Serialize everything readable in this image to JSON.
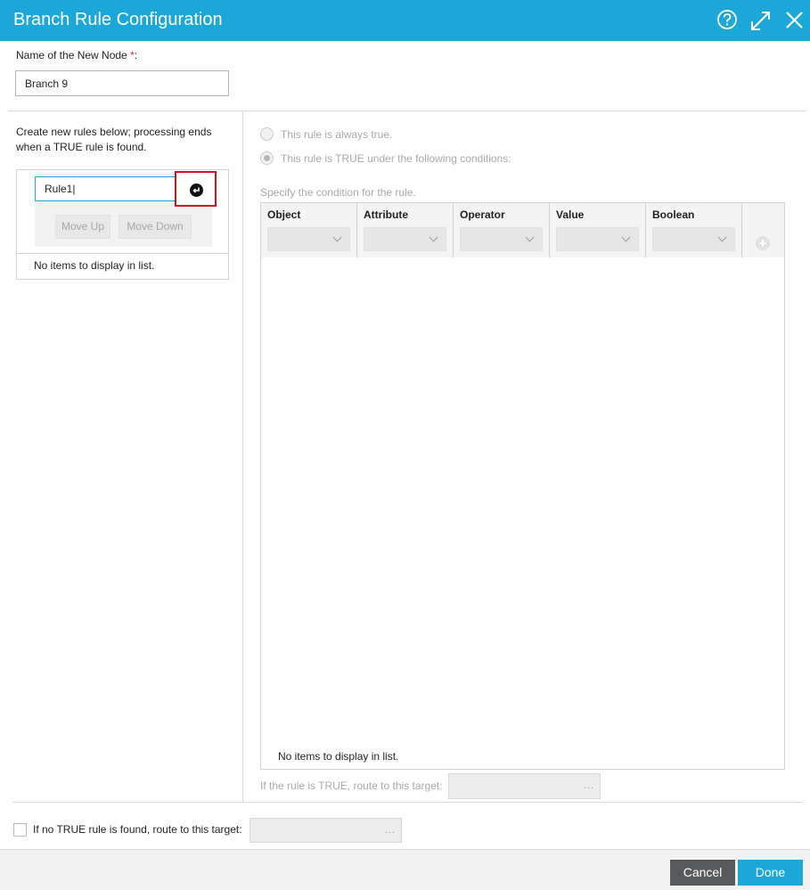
{
  "dialog": {
    "title": "Branch Rule Configuration",
    "accent_color": "#1ba8d8"
  },
  "icons": {
    "help": "help-icon",
    "expand": "expand-icon",
    "close": "close-icon",
    "enter": "enter-icon",
    "add": "add-condition-icon"
  },
  "node_name": {
    "label": "Name of the New Node ",
    "required_mark": "*",
    "label_suffix": ":",
    "value": "Branch 9"
  },
  "rules_panel": {
    "help_text": "Create new rules below; processing ends when a TRUE rule is found.",
    "rule_input_value": "Rule1|",
    "move_up_label": "Move Up",
    "move_down_label": "Move Down",
    "empty_text": "No items to display in list."
  },
  "rule_options": {
    "always_true": "This rule is always true.",
    "conditional": "This rule is TRUE under the following conditions:",
    "specify_label": "Specify the condition for the rule."
  },
  "conditions_table": {
    "columns": [
      "Object",
      "Attribute",
      "Operator",
      "Value",
      "Boolean"
    ],
    "empty_text": "No items to display in list."
  },
  "routing": {
    "true_target_label": "If the rule is TRUE, route to this target:",
    "true_target_value": "...",
    "fallback_label": "If no TRUE rule is found, route to this target:",
    "fallback_value": "..."
  },
  "footer": {
    "cancel_label": "Cancel",
    "done_label": "Done"
  }
}
